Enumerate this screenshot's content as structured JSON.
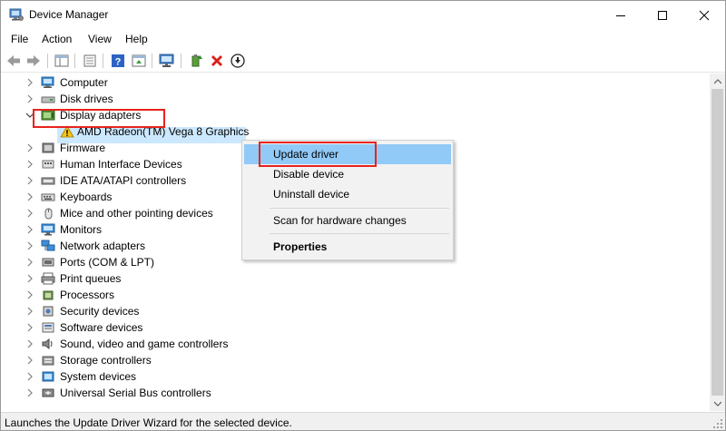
{
  "window": {
    "title": "Device Manager",
    "controls": [
      "minimize-icon",
      "maximize-icon",
      "close-icon"
    ]
  },
  "menu": {
    "items": [
      "File",
      "Action",
      "View",
      "Help"
    ]
  },
  "toolbar": {
    "buttons": [
      "back-icon",
      "forward-icon",
      "properties-grid-icon",
      "list-icon",
      "help-icon",
      "update-driver-icon",
      "computer-monitor-icon",
      "enable-device-icon",
      "uninstall-icon",
      "download-icon"
    ]
  },
  "tree": {
    "nodes": [
      {
        "label": "Computer",
        "icon": "computer-icon",
        "expanded": false
      },
      {
        "label": "Disk drives",
        "icon": "disk-drive-icon",
        "expanded": false
      },
      {
        "label": "Display adapters",
        "icon": "display-adapter-icon",
        "expanded": true,
        "highlighted": true
      },
      {
        "label": "AMD Radeon(TM) Vega 8 Graphics",
        "icon": "warning-icon",
        "child": true,
        "selected": true
      },
      {
        "label": "Firmware",
        "icon": "firmware-icon",
        "expanded": false
      },
      {
        "label": "Human Interface Devices",
        "icon": "hid-icon",
        "expanded": false
      },
      {
        "label": "IDE ATA/ATAPI controllers",
        "icon": "ide-icon",
        "expanded": false
      },
      {
        "label": "Keyboards",
        "icon": "keyboard-icon",
        "expanded": false
      },
      {
        "label": "Mice and other pointing devices",
        "icon": "mouse-icon",
        "expanded": false
      },
      {
        "label": "Monitors",
        "icon": "monitor-icon",
        "expanded": false
      },
      {
        "label": "Network adapters",
        "icon": "network-icon",
        "expanded": false
      },
      {
        "label": "Ports (COM & LPT)",
        "icon": "port-icon",
        "expanded": false
      },
      {
        "label": "Print queues",
        "icon": "printer-icon",
        "expanded": false
      },
      {
        "label": "Processors",
        "icon": "processor-icon",
        "expanded": false
      },
      {
        "label": "Security devices",
        "icon": "security-icon",
        "expanded": false
      },
      {
        "label": "Software devices",
        "icon": "software-icon",
        "expanded": false
      },
      {
        "label": "Sound, video and game controllers",
        "icon": "speaker-icon",
        "expanded": false
      },
      {
        "label": "Storage controllers",
        "icon": "storage-icon",
        "expanded": false
      },
      {
        "label": "System devices",
        "icon": "system-icon",
        "expanded": false
      },
      {
        "label": "Universal Serial Bus controllers",
        "icon": "usb-icon",
        "expanded": false
      }
    ]
  },
  "context_menu": {
    "items": [
      {
        "label": "Update driver",
        "highlighted": true
      },
      {
        "label": "Disable device"
      },
      {
        "label": "Uninstall device"
      },
      {
        "label": "Scan for hardware changes"
      },
      {
        "label": "Properties",
        "bold": true
      }
    ]
  },
  "status": {
    "text": "Launches the Update Driver Wizard for the selected device."
  },
  "colors": {
    "highlight_box": "#e8231c",
    "menu_hover": "#91c9f7",
    "selection": "#cce8ff"
  }
}
